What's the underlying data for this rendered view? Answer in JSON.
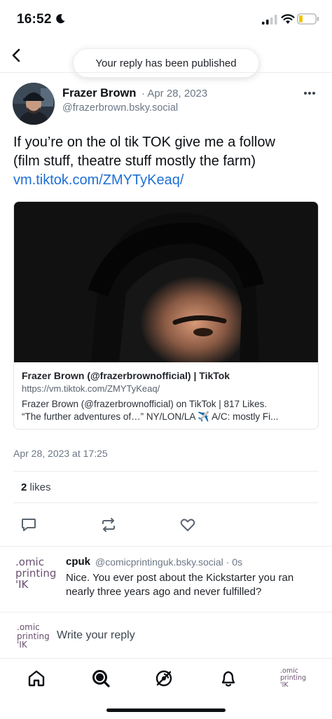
{
  "status_bar": {
    "time": "16:52"
  },
  "header": {
    "toast": "Your reply has been published"
  },
  "post": {
    "author_name": "Frazer Brown",
    "date": "· Apr 28, 2023",
    "handle": "@frazerbrown.bsky.social",
    "text_line1": "If you’re on the ol tik TOK give me a follow",
    "text_line2": "(film stuff, theatre stuff mostly the farm)",
    "link": "vm.tiktok.com/ZMYTyKeaq/",
    "timestamp": "Apr 28, 2023 at 17:25",
    "likes_count": "2",
    "likes_label": " likes"
  },
  "link_card": {
    "title": "Frazer Brown (@frazerbrownofficial) | TikTok",
    "url": "https://vm.tiktok.com/ZMYTyKeaq/",
    "desc_line1": "Frazer Brown (@frazerbrownofficial) on TikTok | 817 Likes.",
    "desc_line2": "“The further adventures of…”  NY/LON/LA ✈️  A/C: mostly Fi..."
  },
  "reply": {
    "name": "cpuk",
    "handle": "@comicprintinguk.bsky.social · 0s",
    "text": "Nice. You ever post about the Kickstarter you ran nearly three years ago and never fulfilled?",
    "avatar_line1": ".omic",
    "avatar_line2": "printing",
    "avatar_line3": "'IK"
  },
  "composer": {
    "placeholder": "Write your reply"
  },
  "icons": {
    "back": "chevron-left-icon",
    "more": "ellipsis-icon",
    "reply": "speech-bubble-icon",
    "repost": "repost-icon",
    "like": "heart-icon",
    "home": "home-icon",
    "search": "search-icon",
    "feeds": "feeds-icon",
    "notifications": "bell-icon"
  },
  "colors": {
    "link": "#1d6fd6",
    "muted": "#6b7785",
    "logo": "#6a4f70"
  }
}
